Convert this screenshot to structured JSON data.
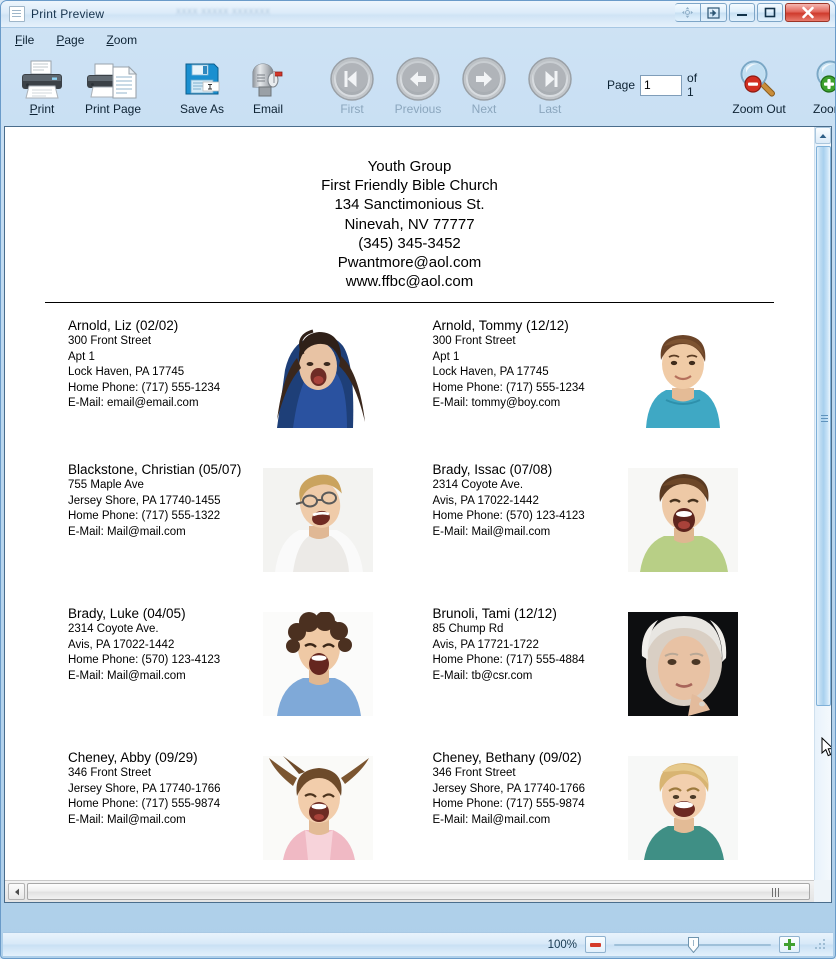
{
  "window": {
    "title": "Print Preview",
    "ghost_title": "xxxx  xxxxx  xxxxxxx",
    "controls": [
      {
        "name": "move-window-button",
        "glyph": "move-icon"
      },
      {
        "name": "dock-window-button",
        "glyph": "dock-icon"
      },
      {
        "name": "minimize-button",
        "glyph": "minimize-icon"
      },
      {
        "name": "maximize-button",
        "glyph": "maximize-icon"
      },
      {
        "name": "close-button",
        "glyph": "close-icon"
      }
    ]
  },
  "menu": [
    {
      "name": "menu-file",
      "accel": "F",
      "rest": "ile"
    },
    {
      "name": "menu-page",
      "accel": "P",
      "rest": "age"
    },
    {
      "name": "menu-zoom",
      "accel": "Z",
      "rest": "oom"
    }
  ],
  "toolbar": {
    "print": {
      "label_accel": "P",
      "label_rest": "rint",
      "icon": "printer-icon",
      "disabled": false
    },
    "print_page": {
      "label": "Print Page",
      "icon": "printer-page-icon",
      "disabled": false
    },
    "save_as": {
      "label": "Save As",
      "icon": "floppy-disk-icon",
      "disabled": false
    },
    "email": {
      "label": "Email",
      "icon": "mailbox-icon",
      "disabled": false
    },
    "first": {
      "label": "First",
      "icon": "first-page-icon",
      "disabled": true
    },
    "previous": {
      "label": "Previous",
      "icon": "previous-page-icon",
      "disabled": true
    },
    "next": {
      "label": "Next",
      "icon": "next-page-icon",
      "disabled": true
    },
    "last": {
      "label": "Last",
      "icon": "last-page-icon",
      "disabled": true
    },
    "page_label": "Page",
    "page_value": "1",
    "page_of": "of 1",
    "zoom_out": {
      "label": "Zoom Out",
      "icon": "magnifier-minus-icon"
    },
    "zoom_in": {
      "label_pre": "Zoom I",
      "label_accel": "n",
      "icon": "magnifier-plus-icon"
    }
  },
  "document": {
    "header": [
      "Youth Group",
      "First Friendly Bible Church",
      "134 Sanctimonious St.",
      "Ninevah, NV 77777",
      "(345) 345-3452",
      "Pwantmore@aol.com",
      "www.ffbc@aol.com"
    ],
    "entries": [
      {
        "name": "Arnold, Liz (02/02)",
        "lines": [
          "300 Front Street",
          "Apt 1",
          "Lock Haven, PA  17745",
          "Home Phone: (717) 555-1234",
          "E-Mail: email@email.com"
        ],
        "photo": "girl-dark-hair-blue-shirt-photo"
      },
      {
        "name": "Arnold, Tommy (12/12)",
        "lines": [
          "300 Front Street",
          "Apt 1",
          "Lock Haven, PA  17745",
          "Home Phone: (717) 555-1234",
          "E-Mail: tommy@boy.com"
        ],
        "photo": "boy-brown-hair-teal-shirt-photo"
      },
      {
        "name": "Blackstone, Christian (05/07)",
        "lines": [
          "755 Maple Ave",
          "Jersey Shore, PA  17740-1455",
          "Home Phone: (717) 555-1322",
          "E-Mail: Mail@mail.com"
        ],
        "photo": "boy-glasses-white-shirt-photo"
      },
      {
        "name": "Brady, Issac (07/08)",
        "lines": [
          "2314 Coyote Ave.",
          "Avis, PA  17022-1442",
          "Home Phone: (570) 123-4123",
          "E-Mail: Mail@mail.com"
        ],
        "photo": "boy-shouting-green-shirt-photo"
      },
      {
        "name": "Brady, Luke (04/05)",
        "lines": [
          "2314 Coyote Ave.",
          "Avis, PA  17022-1442",
          "Home Phone: (570) 123-4123",
          "E-Mail: Mail@mail.com"
        ],
        "photo": "child-curly-hair-blue-shirt-photo"
      },
      {
        "name": "Brunoli, Tami (12/12)",
        "lines": [
          "85 Chump Rd",
          "Avis, PA  17721-1722",
          "Home Phone: (717) 555-4884",
          "E-Mail: tb@csr.com"
        ],
        "photo": "older-woman-white-hair-photo"
      },
      {
        "name": "Cheney, Abby (09/29)",
        "lines": [
          "346 Front Street",
          "Jersey Shore, PA  17740-1766",
          "Home Phone: (717) 555-9874",
          "E-Mail: Mail@mail.com"
        ],
        "photo": "girl-laughing-pink-top-photo"
      },
      {
        "name": "Cheney, Bethany (09/02)",
        "lines": [
          "346 Front Street",
          "Jersey Shore, PA  17740-1766",
          "Home Phone: (717) 555-9874",
          "E-Mail: Mail@mail.com"
        ],
        "photo": "child-blond-teal-shirt-photo"
      }
    ]
  },
  "statusbar": {
    "zoom_percent": "100%",
    "zoom_out_name": "zoom-out-minus-button",
    "zoom_in_name": "zoom-in-plus-button"
  },
  "colors": {
    "accent": "#aecfea",
    "close_red": "#cf3b2d",
    "minus_red": "#d43b2a",
    "plus_green": "#3fa02f",
    "frame_border": "#6a9bc9"
  }
}
